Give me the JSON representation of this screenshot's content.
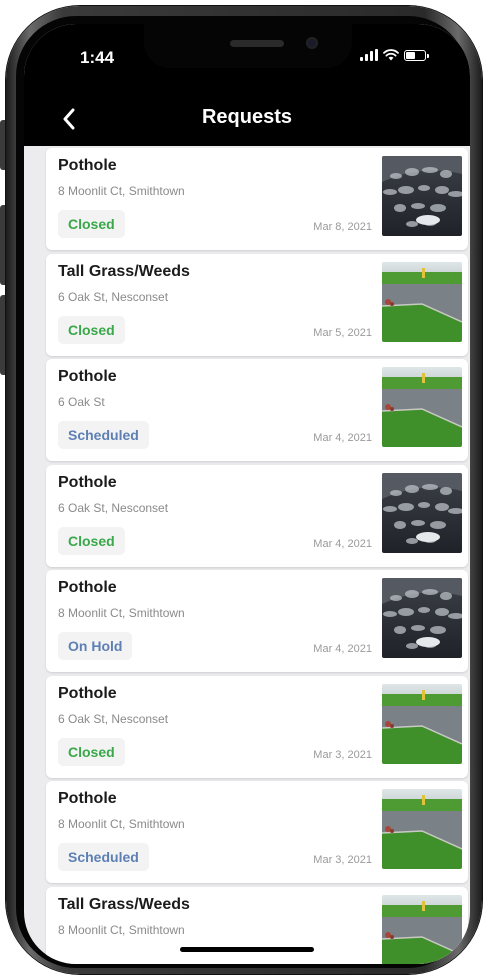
{
  "status_bar": {
    "time": "1:44"
  },
  "nav": {
    "title": "Requests"
  },
  "colors": {
    "closed": "#3aa84a",
    "scheduled": "#5d7fb4",
    "on_hold": "#5d7fb4",
    "header": "#000000"
  },
  "requests": [
    {
      "title": "Pothole",
      "address": "8 Moonlit Ct, Smithtown",
      "status": "Closed",
      "status_type": "closed",
      "date": "Mar 8, 2021",
      "thumbnail_icon": "pothole-photo"
    },
    {
      "title": "Tall Grass/Weeds",
      "address": "6 Oak St, Nesconset",
      "status": "Closed",
      "status_type": "closed",
      "date": "Mar 5, 2021",
      "thumbnail_icon": "grass-photo"
    },
    {
      "title": "Pothole",
      "address": "6 Oak St",
      "status": "Scheduled",
      "status_type": "scheduled",
      "date": "Mar 4, 2021",
      "thumbnail_icon": "grass-photo"
    },
    {
      "title": "Pothole",
      "address": "6 Oak St, Nesconset",
      "status": "Closed",
      "status_type": "closed",
      "date": "Mar 4, 2021",
      "thumbnail_icon": "pothole-photo"
    },
    {
      "title": "Pothole",
      "address": "8 Moonlit Ct, Smithtown",
      "status": "On Hold",
      "status_type": "on_hold",
      "date": "Mar 4, 2021",
      "thumbnail_icon": "pothole-photo"
    },
    {
      "title": "Pothole",
      "address": "6 Oak St, Nesconset",
      "status": "Closed",
      "status_type": "closed",
      "date": "Mar 3, 2021",
      "thumbnail_icon": "grass-photo"
    },
    {
      "title": "Pothole",
      "address": "8 Moonlit Ct, Smithtown",
      "status": "Scheduled",
      "status_type": "scheduled",
      "date": "Mar 3, 2021",
      "thumbnail_icon": "grass-photo"
    },
    {
      "title": "Tall Grass/Weeds",
      "address": "8 Moonlit Ct, Smithtown",
      "status": "",
      "status_type": "closed",
      "date": "",
      "thumbnail_icon": "grass-photo"
    }
  ]
}
